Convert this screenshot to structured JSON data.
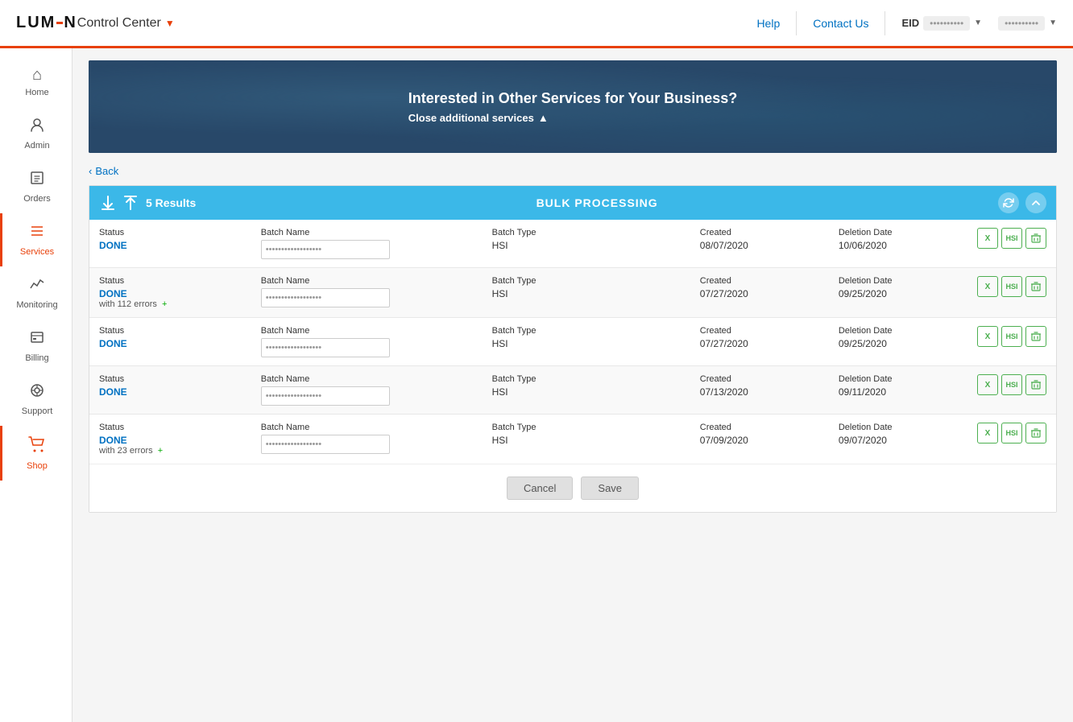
{
  "header": {
    "logo": "LUMEN",
    "control_center_label": "Control Center",
    "help_label": "Help",
    "contact_us_label": "Contact Us",
    "eid_label": "EID",
    "eid_value": "••••••••••",
    "user_value": "••••••••••"
  },
  "sidebar": {
    "items": [
      {
        "id": "home",
        "label": "Home",
        "icon": "⌂",
        "active": false
      },
      {
        "id": "admin",
        "label": "Admin",
        "icon": "👤",
        "active": false
      },
      {
        "id": "orders",
        "label": "Orders",
        "icon": "📥",
        "active": false
      },
      {
        "id": "services",
        "label": "Services",
        "icon": "☰",
        "active": true
      },
      {
        "id": "monitoring",
        "label": "Monitoring",
        "icon": "📈",
        "active": false
      },
      {
        "id": "billing",
        "label": "Billing",
        "icon": "🧾",
        "active": false
      },
      {
        "id": "support",
        "label": "Support",
        "icon": "🔧",
        "active": false
      },
      {
        "id": "shop",
        "label": "Shop",
        "icon": "🛒",
        "active": false
      }
    ]
  },
  "banner": {
    "title": "Interested in Other Services for Your Business?",
    "close_label": "Close additional services"
  },
  "back_label": "Back",
  "table": {
    "header_title": "BULK PROCESSING",
    "results_count": "5 Results",
    "rows": [
      {
        "status_label": "Status",
        "status_value": "DONE",
        "error_text": null,
        "batch_name_label": "Batch Name",
        "batch_name_value": "••••••••••••••••••",
        "batch_type_label": "Batch Type",
        "batch_type_value": "HSI",
        "created_label": "Created",
        "created_value": "08/07/2020",
        "deletion_label": "Deletion Date",
        "deletion_value": "10/06/2020"
      },
      {
        "status_label": "Status",
        "status_value": "DONE",
        "error_text": "with 112 errors",
        "batch_name_label": "Batch Name",
        "batch_name_value": "••••••••••••••••••",
        "batch_type_label": "Batch Type",
        "batch_type_value": "HSI",
        "created_label": "Created",
        "created_value": "07/27/2020",
        "deletion_label": "Deletion Date",
        "deletion_value": "09/25/2020"
      },
      {
        "status_label": "Status",
        "status_value": "DONE",
        "error_text": null,
        "batch_name_label": "Batch Name",
        "batch_name_value": "••••••••••••••••••",
        "batch_type_label": "Batch Type",
        "batch_type_value": "HSI",
        "created_label": "Created",
        "created_value": "07/27/2020",
        "deletion_label": "Deletion Date",
        "deletion_value": "09/25/2020"
      },
      {
        "status_label": "Status",
        "status_value": "DONE",
        "error_text": null,
        "batch_name_label": "Batch Name",
        "batch_name_value": "••••••••••••••••••",
        "batch_type_label": "Batch Type",
        "batch_type_value": "HSI",
        "created_label": "Created",
        "created_value": "07/13/2020",
        "deletion_label": "Deletion Date",
        "deletion_value": "09/11/2020"
      },
      {
        "status_label": "Status",
        "status_value": "DONE",
        "error_text": "with 23 errors",
        "batch_name_label": "Batch Name",
        "batch_name_value": "••••••••••••••••••",
        "batch_type_label": "Batch Type",
        "batch_type_value": "HSI",
        "created_label": "Created",
        "created_value": "07/09/2020",
        "deletion_label": "Deletion Date",
        "deletion_value": "09/07/2020"
      }
    ]
  },
  "footer": {
    "cancel_label": "Cancel",
    "save_label": "Save"
  },
  "colors": {
    "accent_orange": "#e8400a",
    "accent_blue": "#0071c2",
    "header_bar": "#3bb8e8",
    "done_color": "#0071c2",
    "green": "#4caf50"
  }
}
